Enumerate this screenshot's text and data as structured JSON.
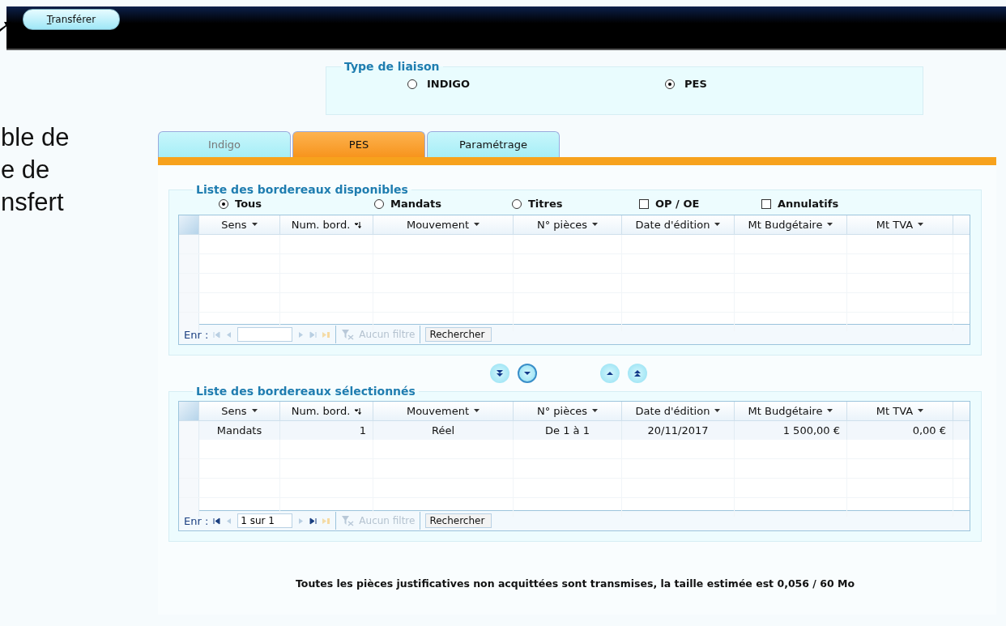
{
  "toolbar": {
    "button": "Transférer"
  },
  "slide_text": [
    "ble de",
    "e de",
    "nsfert"
  ],
  "liaison": {
    "title": "Type de liaison",
    "options": [
      {
        "label": "INDIGO",
        "selected": false
      },
      {
        "label": "PES",
        "selected": true
      }
    ]
  },
  "tabs": [
    {
      "label": "Indigo",
      "selected": false
    },
    {
      "label": "PES",
      "selected": true
    },
    {
      "label": "Paramétrage",
      "selected": false
    }
  ],
  "available": {
    "title": "Liste des bordereaux disponibles",
    "filters": [
      {
        "kind": "radio",
        "label": "Tous",
        "checked": true
      },
      {
        "kind": "radio",
        "label": "Mandats",
        "checked": false
      },
      {
        "kind": "radio",
        "label": "Titres",
        "checked": false
      },
      {
        "kind": "checkbox",
        "label": "OP / OE",
        "checked": false
      },
      {
        "kind": "checkbox",
        "label": "Annulatifs",
        "checked": false
      }
    ],
    "columns": [
      "Sens",
      "Num. bord.",
      "Mouvement",
      "N° pièces",
      "Date d'édition",
      "Mt Budgétaire",
      "Mt TVA"
    ],
    "nav": {
      "label": "Enr :",
      "filter": "Aucun filtre",
      "search": "Rechercher"
    }
  },
  "selected": {
    "title": "Liste des bordereaux sélectionnés",
    "columns": [
      "Sens",
      "Num. bord.",
      "Mouvement",
      "N° pièces",
      "Date d'édition",
      "Mt Budgétaire",
      "Mt TVA"
    ],
    "rows": [
      [
        "Mandats",
        "1",
        "Réel",
        "De 1 à 1",
        "20/11/2017",
        "1 500,00 €",
        "0,00 €"
      ]
    ],
    "nav": {
      "label": "Enr :",
      "record": "1 sur 1",
      "filter": "Aucun filtre",
      "search": "Rechercher"
    }
  },
  "footer": "Toutes les pièces justificatives non acquittées sont transmises, la taille estimée est 0,056 / 60 Mo"
}
